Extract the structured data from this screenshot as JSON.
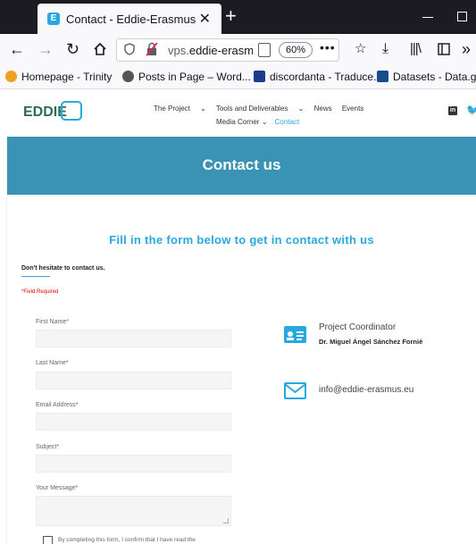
{
  "browser": {
    "tab_title": "Contact - Eddie-Erasmus",
    "tab_favicon_letter": "E",
    "url_prefix": "vps.",
    "url_domain": "eddie-erasmus.",
    "zoom": "60%",
    "bookmarks": [
      {
        "label": "Homepage - Trinity",
        "icon_color": "#f0a020"
      },
      {
        "label": "Posts in Page – Word...",
        "icon_color": "#555555"
      },
      {
        "label": "discordanta - Traduce...",
        "icon_color": "#1a3a8a"
      },
      {
        "label": "Datasets - Data.gov",
        "icon_color": "#1a4b8c"
      }
    ]
  },
  "site": {
    "logo_text": "EDDIE",
    "nav": {
      "project": "The Project",
      "tools": "Tools and Deliverables",
      "news": "News",
      "events": "Events",
      "media": "Media Corner",
      "contact": "Contact"
    },
    "banner_title": "Contact us",
    "form_heading": "Fill in the form below to get in contact with us",
    "hesitate": "Don't hesitate to contact us.",
    "required": "*Field Required",
    "fields": {
      "first_name": "First Name*",
      "last_name": "Last Name*",
      "email": "Email Address*",
      "subject": "Subject*",
      "message": "Your Message*"
    },
    "consent": "By completing this form, I confirm that I have read the",
    "coordinator_role": "Project Coordinator",
    "coordinator_name": "Dr. Miguel Ángel Sánchez Fornié",
    "email": "info@eddie-erasmus.eu"
  },
  "colors": {
    "accent": "#29a8e0",
    "banner": "#3a92b5"
  }
}
